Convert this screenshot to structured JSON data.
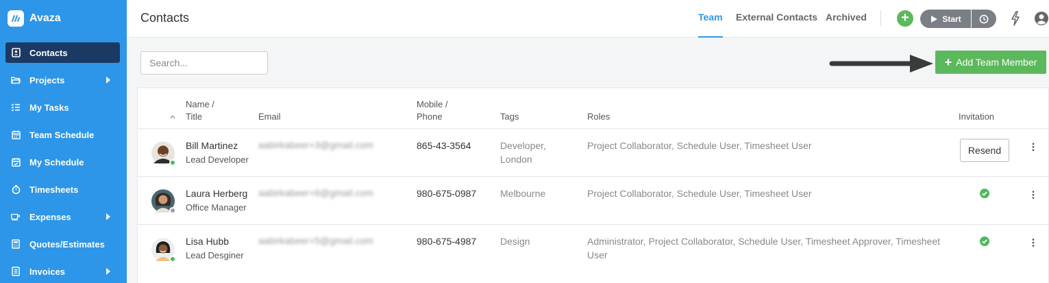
{
  "app": {
    "name": "Avaza"
  },
  "sidebar": {
    "items": [
      {
        "label": "Contacts",
        "icon": "contact-card-icon",
        "active": true
      },
      {
        "label": "Projects",
        "icon": "folder-icon",
        "caret": true
      },
      {
        "label": "My Tasks",
        "icon": "tasks-list-icon"
      },
      {
        "label": "Team Schedule",
        "icon": "calendar-icon"
      },
      {
        "label": "My Schedule",
        "icon": "calendar-check-icon"
      },
      {
        "label": "Timesheets",
        "icon": "stopwatch-icon"
      },
      {
        "label": "Expenses",
        "icon": "coffee-cup-icon",
        "caret": true
      },
      {
        "label": "Quotes/Estimates",
        "icon": "calculator-icon"
      },
      {
        "label": "Invoices",
        "icon": "invoice-icon",
        "caret": true
      }
    ]
  },
  "header": {
    "title": "Contacts",
    "tabs": [
      {
        "label": "Team",
        "active": true
      },
      {
        "label": "External Contacts"
      },
      {
        "label": "Archived"
      }
    ],
    "timer": {
      "start_label": "Start"
    }
  },
  "toolbar": {
    "search_placeholder": "Search...",
    "add_label": "Add Team Member"
  },
  "table": {
    "headers": {
      "name_line1": "Name /",
      "name_line2": "Title",
      "email": "Email",
      "mobile_line1": "Mobile /",
      "mobile_line2": "Phone",
      "tags": "Tags",
      "roles": "Roles",
      "invitation": "Invitation"
    },
    "rows": [
      {
        "name": "Bill Martinez",
        "title": "Lead Developer",
        "email": "aabirkabeer+3@gmail.com",
        "phone": "865-43-3564",
        "tags_line1": "Developer,",
        "tags_line2": "London",
        "roles_line1": "Project Collaborator, Schedule User, Timesheet User",
        "roles_line2": "",
        "invitation": "Resend",
        "status": "online"
      },
      {
        "name": "Laura Herberg",
        "title": "Office Manager",
        "email": "aabirkabeer+6@gmail.com",
        "phone": "980-675-0987",
        "tags_line1": "Melbourne",
        "tags_line2": "",
        "roles_line1": "Project Collaborator, Schedule User, Timesheet User",
        "roles_line2": "",
        "invitation": "accepted",
        "status": "offline"
      },
      {
        "name": "Lisa Hubb",
        "title": "Lead Desginer",
        "email": "aabirkabeer+5@gmail.com",
        "phone": "980-675-4987",
        "tags_line1": "Design",
        "tags_line2": "",
        "roles_line1": "Administrator, Project Collaborator, Schedule User, Timesheet Approver, Timesheet",
        "roles_line2": "User",
        "invitation": "accepted",
        "status": "online"
      }
    ]
  },
  "colors": {
    "sidebar": "#2d96e8",
    "active_nav": "#1b3a63",
    "accent": "#2d96e8",
    "success": "#5cb85c",
    "online": "#4cbb5a",
    "offline": "#9aa0a6"
  }
}
